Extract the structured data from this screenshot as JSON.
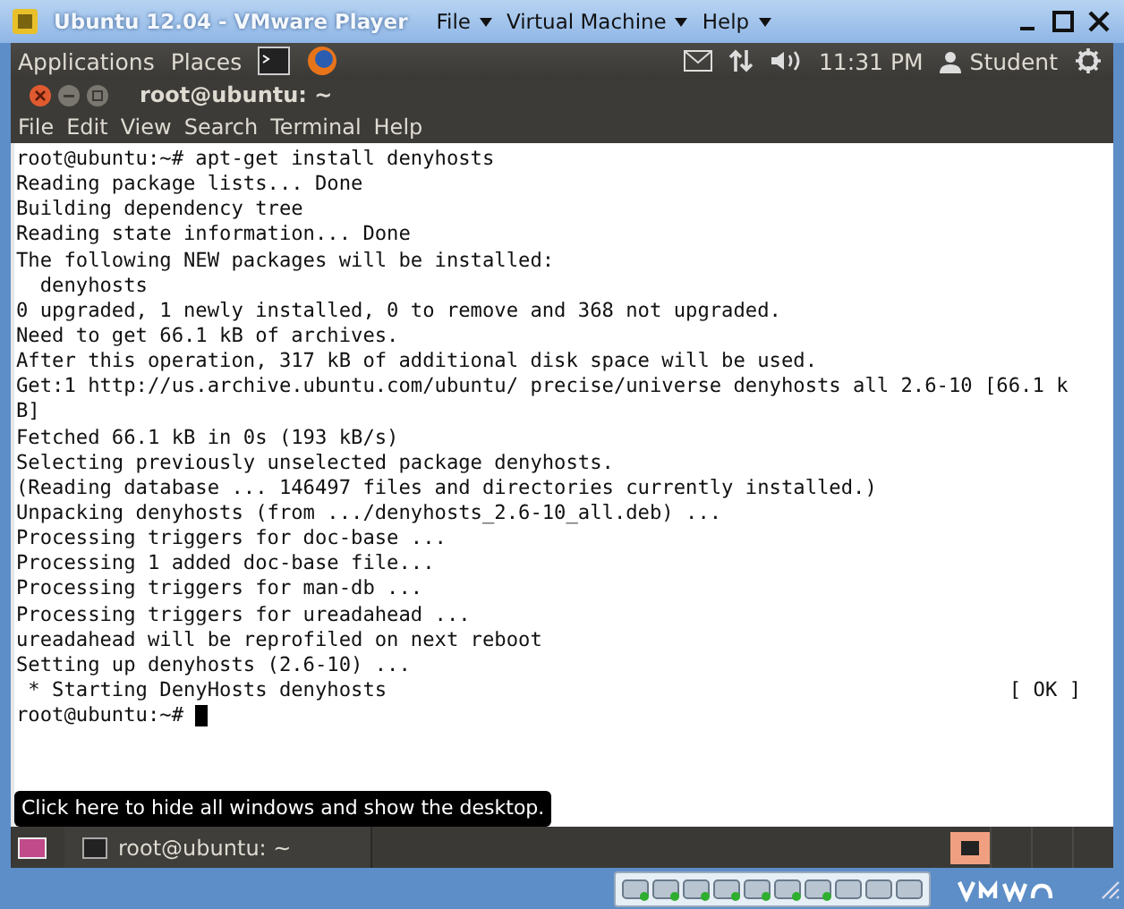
{
  "window": {
    "title": "Ubuntu 12.04 - VMware Player",
    "menus": [
      {
        "label": "File"
      },
      {
        "label": "Virtual Machine"
      },
      {
        "label": "Help"
      }
    ]
  },
  "top_panel": {
    "menus": [
      "Applications",
      "Places"
    ],
    "clock": "11:31 PM",
    "user": "Student"
  },
  "terminal": {
    "title": "root@ubuntu: ~",
    "menus": [
      "File",
      "Edit",
      "View",
      "Search",
      "Terminal",
      "Help"
    ],
    "lines": [
      {
        "text": "root@ubuntu:~# apt-get install denyhosts"
      },
      {
        "text": "Reading package lists... Done"
      },
      {
        "text": "Building dependency tree"
      },
      {
        "text": "Reading state information... Done"
      },
      {
        "text": "The following NEW packages will be installed:"
      },
      {
        "text": "  denyhosts"
      },
      {
        "text": "0 upgraded, 1 newly installed, 0 to remove and 368 not upgraded."
      },
      {
        "text": "Need to get 66.1 kB of archives."
      },
      {
        "text": "After this operation, 317 kB of additional disk space will be used."
      },
      {
        "text": "Get:1 http://us.archive.ubuntu.com/ubuntu/ precise/universe denyhosts all 2.6-10 [66.1 k"
      },
      {
        "text": "B]"
      },
      {
        "text": "Fetched 66.1 kB in 0s (193 kB/s)"
      },
      {
        "text": "Selecting previously unselected package denyhosts."
      },
      {
        "text": "(Reading database ... 146497 files and directories currently installed.)"
      },
      {
        "text": "Unpacking denyhosts (from .../denyhosts_2.6-10_all.deb) ..."
      },
      {
        "text": "Processing triggers for doc-base ..."
      },
      {
        "text": "Processing 1 added doc-base file..."
      },
      {
        "text": "Processing triggers for man-db ..."
      },
      {
        "text": "Processing triggers for ureadahead ..."
      },
      {
        "text": "ureadahead will be reprofiled on next reboot"
      },
      {
        "text": "Setting up denyhosts (2.6-10) ..."
      },
      {
        "text": " * Starting DenyHosts denyhosts",
        "status": "[ OK ]"
      },
      {
        "text": "root@ubuntu:~# ",
        "cursor": true
      }
    ]
  },
  "tooltip": "Click here to hide all windows and show the desktop.",
  "taskbar": {
    "items": [
      {
        "label": "root@ubuntu: ~",
        "selected": false
      }
    ]
  }
}
